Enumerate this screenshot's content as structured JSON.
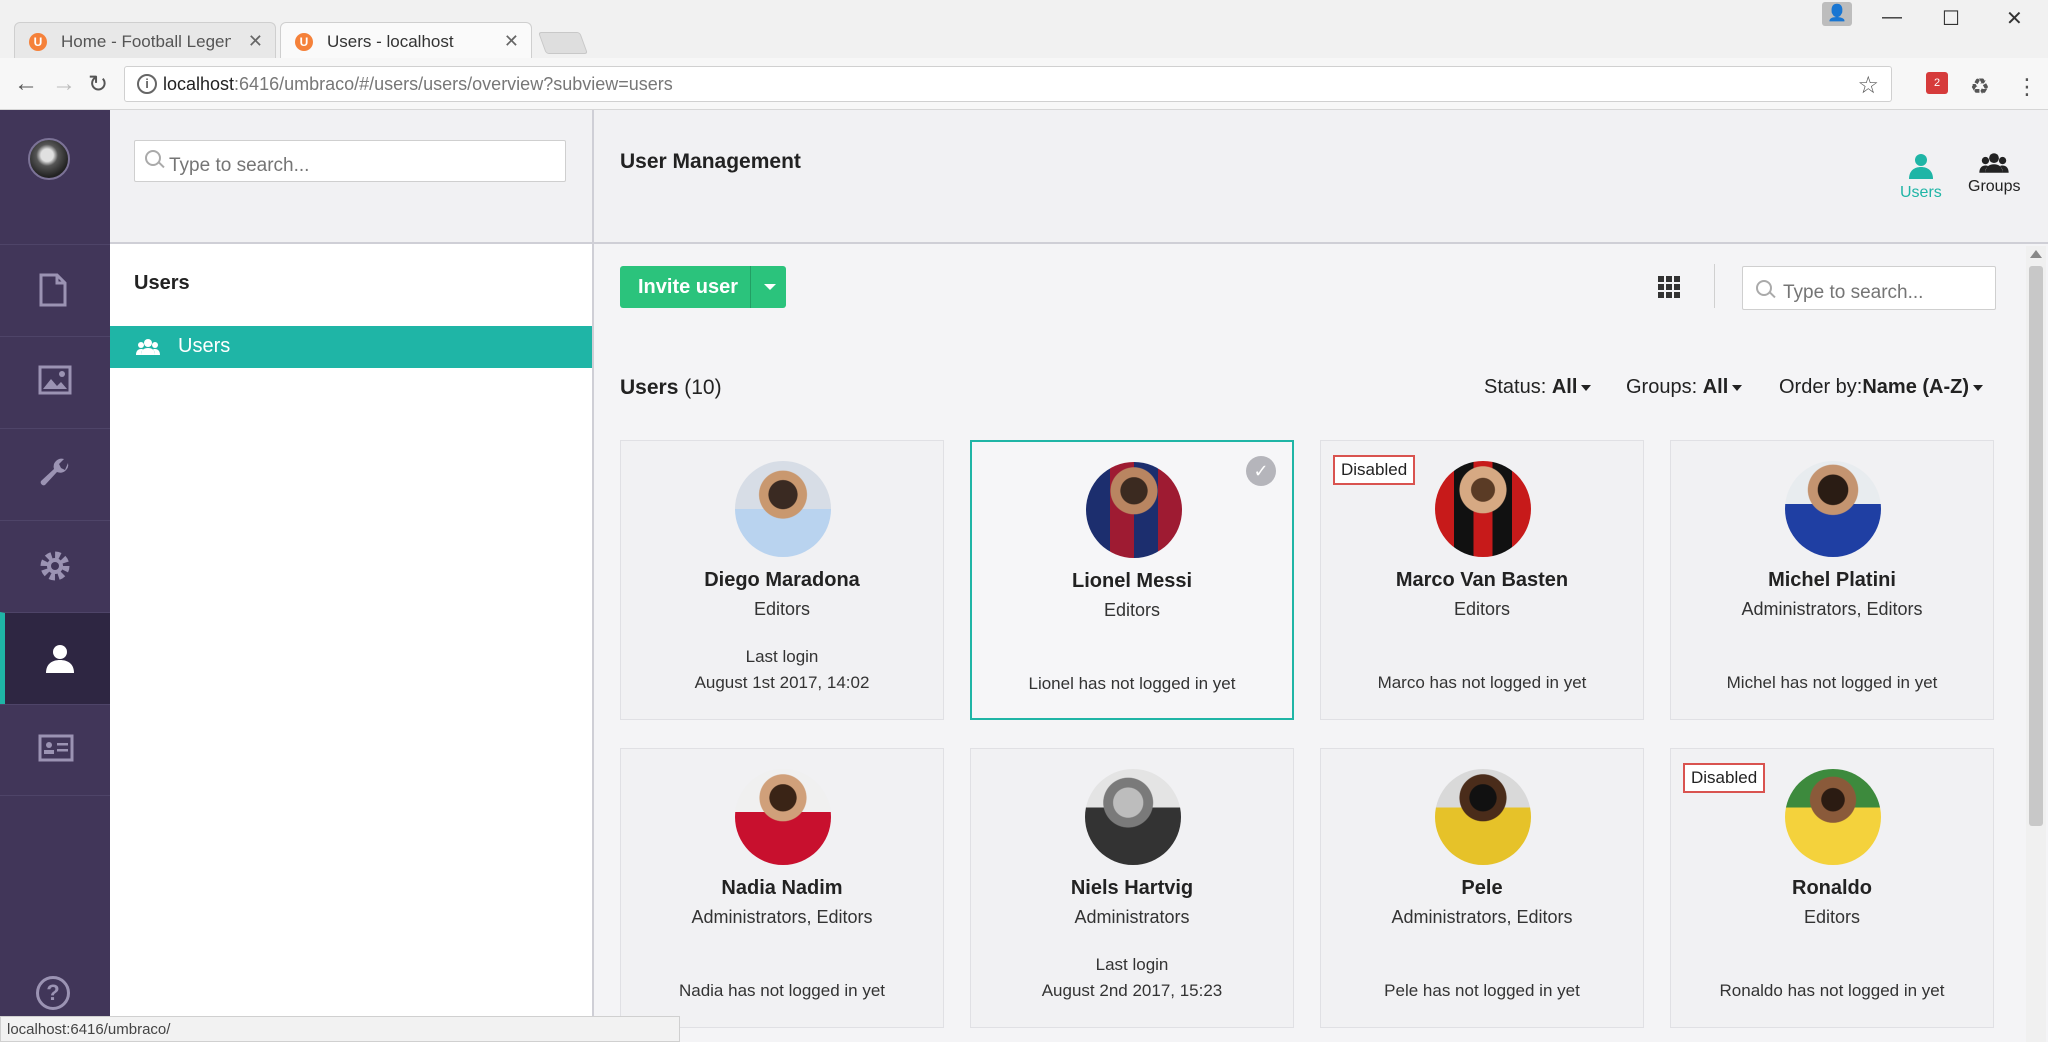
{
  "browser": {
    "tabs": [
      {
        "title": "Home - Football Legends",
        "active": false
      },
      {
        "title": "Users - localhost",
        "active": true
      }
    ],
    "url_host": "localhost",
    "url_path": ":6416/umbraco/#/users/users/overview?subview=users",
    "status_url": "localhost:6416/umbraco/",
    "extension_badge": "2"
  },
  "tree": {
    "search_placeholder": "Type to search...",
    "title": "Users",
    "items": [
      {
        "label": "Users"
      }
    ]
  },
  "main": {
    "title": "User Management",
    "app_tabs": [
      {
        "label": "Users"
      },
      {
        "label": "Groups"
      }
    ],
    "invite_label": "Invite user",
    "search_placeholder": "Type to search...",
    "users_label": "Users",
    "users_count": "(10)",
    "filters": {
      "status_label": "Status:",
      "status_value": "All",
      "groups_label": "Groups:",
      "groups_value": "All",
      "order_label": "Order by:",
      "order_value": "Name (A-Z)"
    },
    "disabled_label": "Disabled",
    "cards": [
      {
        "name": "Diego Maradona",
        "groups": "Editors",
        "login1": "Last login",
        "login2": "August 1st 2017, 14:02"
      },
      {
        "name": "Lionel Messi",
        "groups": "Editors",
        "login1": "",
        "login2": "Lionel has not logged in yet"
      },
      {
        "name": "Marco Van Basten",
        "groups": "Editors",
        "login1": "",
        "login2": "Marco has not logged in yet"
      },
      {
        "name": "Michel Platini",
        "groups": "Administrators, Editors",
        "login1": "",
        "login2": "Michel has not logged in yet"
      },
      {
        "name": "Nadia Nadim",
        "groups": "Administrators, Editors",
        "login1": "",
        "login2": "Nadia has not logged in yet"
      },
      {
        "name": "Niels Hartvig",
        "groups": "Administrators",
        "login1": "Last login",
        "login2": "August 2nd 2017, 15:23"
      },
      {
        "name": "Pele",
        "groups": "Administrators, Editors",
        "login1": "",
        "login2": "Pele has not logged in yet"
      },
      {
        "name": "Ronaldo",
        "groups": "Editors",
        "login1": "",
        "login2": "Ronaldo has not logged in yet"
      }
    ]
  },
  "colors": {
    "accent": "#1fb5a6",
    "nav_bg": "#413659",
    "invite_green": "#2bc37c",
    "disabled_red": "#d9534f"
  }
}
